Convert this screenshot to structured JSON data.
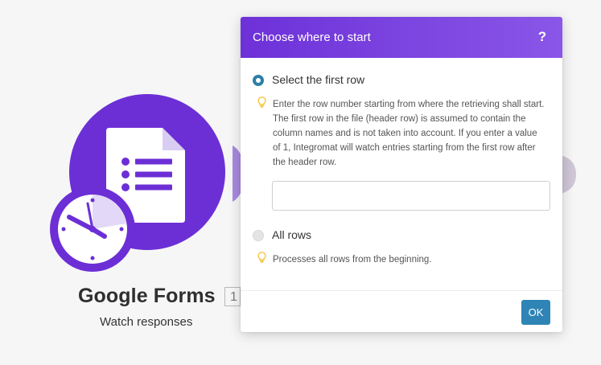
{
  "module": {
    "title": "Google Forms",
    "badge": "1",
    "subtitle": "Watch responses",
    "icon": "google-forms-icon",
    "trigger_icon": "clock-icon",
    "color": "#6c2fd6"
  },
  "dialog": {
    "title": "Choose where to start",
    "help_glyph": "?",
    "header_colors": [
      "#6d31d8",
      "#8a56e8"
    ],
    "options": [
      {
        "label": "Select the first row",
        "selected": true,
        "help": "Enter the row number starting from where the retrieving shall start. The first row in the file (header row) is assumed to contain the column names and is not taken into account. If you enter a value of 1, Integromat will watch entries starting from the first row after the header row."
      },
      {
        "label": "All rows",
        "selected": false,
        "help": "Processes all rows from the beginning."
      }
    ],
    "row_input": {
      "value": "",
      "placeholder": ""
    },
    "ok_label": "OK",
    "ok_color": "#2e84b5",
    "radio_color": "#2d7fa6",
    "tip_icon_color": "#f4c542"
  }
}
